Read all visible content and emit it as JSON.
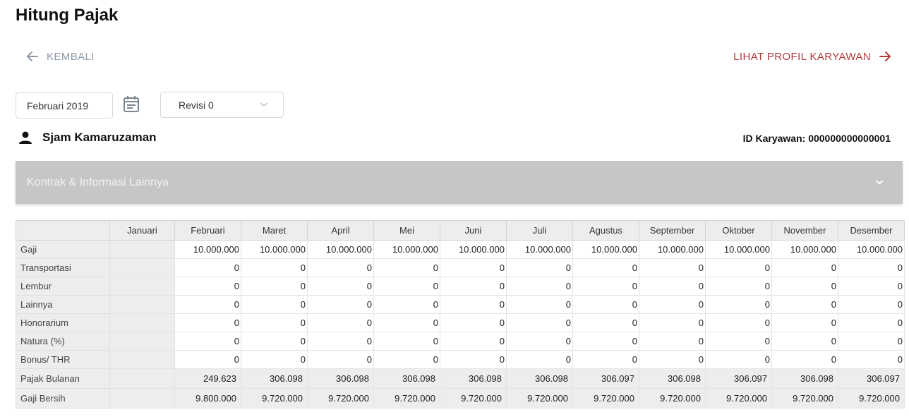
{
  "page": {
    "title": "Hitung Pajak"
  },
  "nav": {
    "back_label": "KEMBALI",
    "profile_label": "LIHAT PROFIL KARYAWAN"
  },
  "filters": {
    "period_value": "Februari 2019",
    "revision_value": "Revisi 0"
  },
  "employee": {
    "name": "Sjam Kamaruzaman",
    "id_label": "ID Karyawan: 000000000000001"
  },
  "accordion": {
    "title": "Kontrak & Informasi Lainnya"
  },
  "colors": {
    "accent_red": "#b23a3a",
    "muted_gray": "#8f9aa6",
    "accordion_bg": "#c6c6c6",
    "header_bg": "#ededed"
  },
  "icons": [
    "arrow-left-icon",
    "arrow-right-icon",
    "calendar-icon",
    "chevron-down-icon",
    "person-icon"
  ],
  "table": {
    "months": [
      "Januari",
      "Februari",
      "Maret",
      "April",
      "Mei",
      "Juni",
      "Juli",
      "Agustus",
      "September",
      "Oktober",
      "November",
      "Desember"
    ],
    "rows": [
      {
        "label": "Gaji",
        "values": [
          "",
          "10.000.000",
          "10.000.000",
          "10.000.000",
          "10.000.000",
          "10.000.000",
          "10.000.000",
          "10.000.000",
          "10.000.000",
          "10.000.000",
          "10.000.000",
          "10.000.000"
        ]
      },
      {
        "label": "Transportasi",
        "values": [
          "",
          "0",
          "0",
          "0",
          "0",
          "0",
          "0",
          "0",
          "0",
          "0",
          "0",
          "0"
        ]
      },
      {
        "label": "Lembur",
        "values": [
          "",
          "0",
          "0",
          "0",
          "0",
          "0",
          "0",
          "0",
          "0",
          "0",
          "0",
          "0"
        ]
      },
      {
        "label": "Lainnya",
        "values": [
          "",
          "0",
          "0",
          "0",
          "0",
          "0",
          "0",
          "0",
          "0",
          "0",
          "0",
          "0"
        ]
      },
      {
        "label": "Honorarium",
        "values": [
          "",
          "0",
          "0",
          "0",
          "0",
          "0",
          "0",
          "0",
          "0",
          "0",
          "0",
          "0"
        ]
      },
      {
        "label": "Natura (%)",
        "values": [
          "",
          "0",
          "0",
          "0",
          "0",
          "0",
          "0",
          "0",
          "0",
          "0",
          "0",
          "0"
        ]
      },
      {
        "label": "Bonus/ THR",
        "values": [
          "",
          "0",
          "0",
          "0",
          "0",
          "0",
          "0",
          "0",
          "0",
          "0",
          "0",
          "0"
        ]
      }
    ],
    "summary_rows": [
      {
        "label": "Pajak Bulanan",
        "values": [
          "",
          "249.623",
          "306.098",
          "306.098",
          "306.098",
          "306.098",
          "306.098",
          "306.097",
          "306.098",
          "306.097",
          "306.098",
          "306.097"
        ]
      },
      {
        "label": "Gaji Bersih",
        "values": [
          "",
          "9.800.000",
          "9.720.000",
          "9.720.000",
          "9.720.000",
          "9.720.000",
          "9.720.000",
          "9.720.000",
          "9.720.000",
          "9.720.000",
          "9.720.000",
          "9.720.000"
        ]
      }
    ]
  }
}
